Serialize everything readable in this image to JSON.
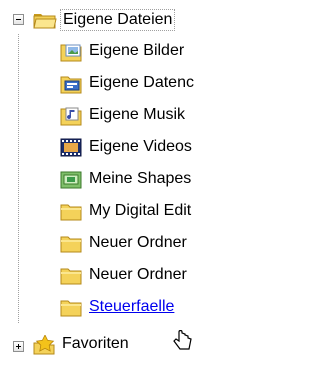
{
  "tree": {
    "root": {
      "label": "Eigene Dateien",
      "expanded": true,
      "icon": "folder-open-icon"
    },
    "children": [
      {
        "label": "Eigene Bilder",
        "icon": "my-pictures-icon"
      },
      {
        "label": "Eigene Datenc",
        "icon": "my-data-sources-icon"
      },
      {
        "label": "Eigene Musik",
        "icon": "my-music-icon"
      },
      {
        "label": "Eigene Videos",
        "icon": "my-videos-icon"
      },
      {
        "label": "Meine Shapes",
        "icon": "my-shapes-icon"
      },
      {
        "label": "My Digital Edit",
        "icon": "folder-icon"
      },
      {
        "label": "Neuer Ordner",
        "icon": "folder-icon"
      },
      {
        "label": "Neuer Ordner",
        "icon": "folder-icon"
      },
      {
        "label": "Steuerfaelle",
        "icon": "folder-icon",
        "hovered": true
      }
    ],
    "favorites": {
      "label": "Favoriten",
      "expanded": false,
      "icon": "star-icon"
    }
  },
  "colors": {
    "folder": "#f4d25a",
    "folder_dark": "#c89a1a",
    "link": "#0000ee",
    "star": "#f3c21a"
  }
}
